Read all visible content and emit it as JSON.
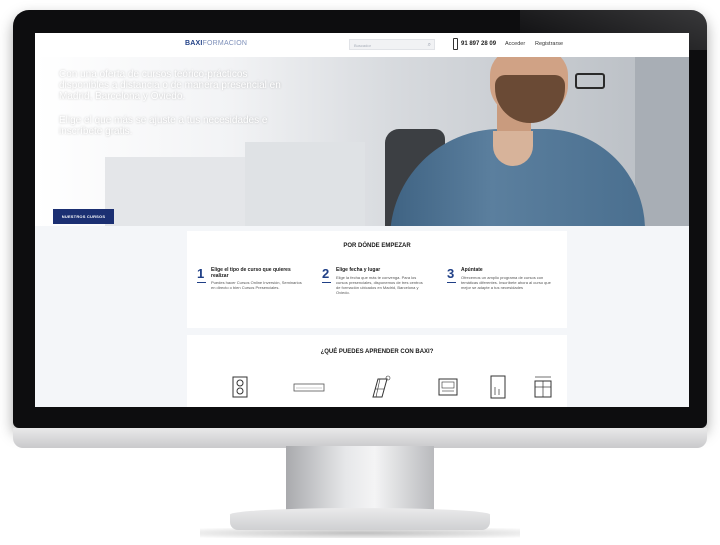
{
  "nav": {
    "logo_brand": "BAXI",
    "logo_sub": "FORMACION",
    "search_placeholder": "Buscador",
    "phone": "91 897 28 09",
    "login": "Acceder",
    "register": "Registrarse"
  },
  "hero": {
    "line1": "Con una oferta de cursos teórico-prácticos disponibles a distancia o de manera presencial en Madrid, Barcelona y Oviedo.",
    "line2": "Elige el que más se ajuste a tus necesidades e inscríbete gratis.",
    "cta": "NUESTROS CURSOS"
  },
  "start": {
    "title": "POR DÓNDE EMPEZAR",
    "steps": [
      {
        "num": "1",
        "title": "Elige el tipo de curso que quieres realizar",
        "desc": "Puedes hacer Cursos Online Inversión, Seminarios en directo o bien Cursos Presenciales."
      },
      {
        "num": "2",
        "title": "Elige fecha y lugar",
        "desc": "Elige la fecha que más te convenga. Para los cursos presenciales, disponemos de tres centros de formación ubicados en Madrid, Barcelona y Oviedo."
      },
      {
        "num": "3",
        "title": "Apúntate",
        "desc": "Ofrecemos un amplio programa de cursos con temáticas diferentes. Inscríbete ahora al curso que mejor se adapte a tus necesidades"
      }
    ]
  },
  "learn": {
    "title": "¿QUÉ PUEDES APRENDER CON BAXI?",
    "courses": [
      {
        "icon": "speaker-unit-icon"
      },
      {
        "icon": "split-ac-icon"
      },
      {
        "icon": "solar-panel-icon"
      },
      {
        "icon": "display-panel-icon"
      },
      {
        "icon": "boiler-icon"
      },
      {
        "icon": "heat-pump-icon"
      }
    ]
  }
}
